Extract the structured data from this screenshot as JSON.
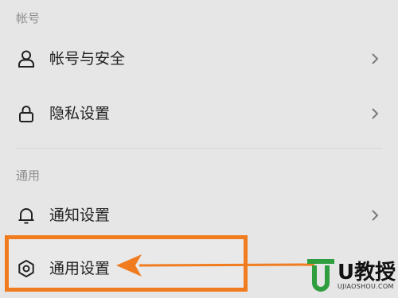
{
  "sections": [
    {
      "header": "帐号"
    },
    {
      "header": "通用"
    }
  ],
  "rows": [
    {
      "label": "帐号与安全",
      "icon": "user-icon"
    },
    {
      "label": "隐私设置",
      "icon": "lock-icon"
    },
    {
      "label": "通知设置",
      "icon": "bell-icon"
    },
    {
      "label": "通用设置",
      "icon": "gear-icon"
    }
  ],
  "watermark": {
    "brand": "U教授",
    "url": "UJIAOSHOU.COM"
  },
  "colors": {
    "background": "#e6e6e6",
    "highlight_border": "#f07c1f",
    "arrow": "#f07c1f",
    "logo_green": "#2e9e3f"
  }
}
